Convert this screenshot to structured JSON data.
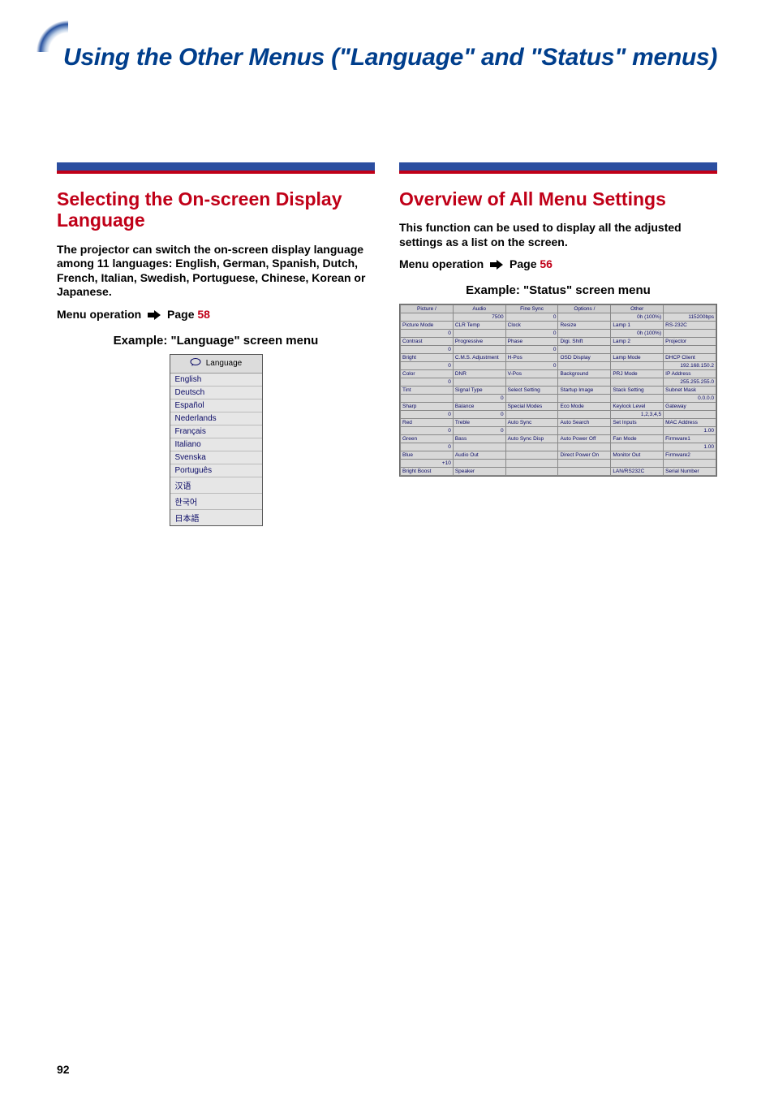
{
  "page_title": "Using the Other Menus (\"Language\" and \"Status\" menus)",
  "page_number": "92",
  "left": {
    "heading": "Selecting the On-screen Display Language",
    "body": "The projector can switch the on-screen display language among 11 languages: English, German, Spanish, Dutch, French, Italian, Swedish, Portuguese, Chinese, Korean or Japanese.",
    "menu_op_text": "Menu operation",
    "menu_op_page_label": "Page",
    "menu_op_page_num": "58",
    "example_label": "Example: \"Language\" screen menu",
    "language_header": "Language",
    "languages": [
      "English",
      "Deutsch",
      "Español",
      "Nederlands",
      "Français",
      "Italiano",
      "Svenska",
      "Português",
      "汉语",
      "한국어",
      "日本語"
    ]
  },
  "right": {
    "heading": "Overview of All Menu Settings",
    "body": "This function can be used to display all the adjusted settings as a list on the screen.",
    "menu_op_text": "Menu operation",
    "menu_op_page_label": "Page",
    "menu_op_page_num": "56",
    "example_label": "Example: \"Status\" screen menu",
    "status_headers": [
      "Picture",
      "Audio",
      "Fine Sync",
      "Options",
      "Other"
    ],
    "status_rows": [
      [
        {
          "l": "Picture Mode",
          "v": ""
        },
        {
          "l": "CLR Temp",
          "v": "7500"
        },
        {
          "l": "Clock",
          "v": "0"
        },
        {
          "l": "Resize",
          "v": ""
        },
        {
          "l": "Lamp 1",
          "v": "0h (100%)"
        },
        {
          "l": "RS-232C",
          "v": "115200bps"
        }
      ],
      [
        {
          "l": "Contrast",
          "v": "0"
        },
        {
          "l": "Progressive",
          "v": ""
        },
        {
          "l": "Phase",
          "v": "0"
        },
        {
          "l": "Digi. Shift",
          "v": ""
        },
        {
          "l": "Lamp 2",
          "v": "0h (100%)"
        },
        {
          "l": "Projector",
          "v": ""
        }
      ],
      [
        {
          "l": "Bright",
          "v": "0"
        },
        {
          "l": "C.M.S. Adjustment",
          "v": ""
        },
        {
          "l": "H-Pos",
          "v": "0"
        },
        {
          "l": "OSD Display",
          "v": ""
        },
        {
          "l": "Lamp Mode",
          "v": ""
        },
        {
          "l": "DHCP Client",
          "v": ""
        }
      ],
      [
        {
          "l": "Color",
          "v": "0"
        },
        {
          "l": "DNR",
          "v": ""
        },
        {
          "l": "V-Pos",
          "v": "0"
        },
        {
          "l": "Background",
          "v": ""
        },
        {
          "l": "PRJ Mode",
          "v": ""
        },
        {
          "l": "IP Address",
          "v": "192.168.150.2"
        }
      ],
      [
        {
          "l": "Tint",
          "v": "0"
        },
        {
          "l": "Signal Type",
          "v": ""
        },
        {
          "l": "Select Setting",
          "v": ""
        },
        {
          "l": "Startup Image",
          "v": ""
        },
        {
          "l": "Stack Setting",
          "v": ""
        },
        {
          "l": "Subnet Mask",
          "v": "255.255.255.0"
        }
      ],
      [
        {
          "l": "Sharp",
          "v": ""
        },
        {
          "l": "Balance",
          "v": "0"
        },
        {
          "l": "Special Modes",
          "v": ""
        },
        {
          "l": "Eco Mode",
          "v": ""
        },
        {
          "l": "Keylock Level",
          "v": ""
        },
        {
          "l": "Gateway",
          "v": "0.0.0.0"
        }
      ],
      [
        {
          "l": "Red",
          "v": "0"
        },
        {
          "l": "Treble",
          "v": "0"
        },
        {
          "l": "Auto Sync",
          "v": ""
        },
        {
          "l": "Auto Search",
          "v": ""
        },
        {
          "l": "Set Inputs",
          "v": "1,2,3,4,5"
        },
        {
          "l": "MAC Address",
          "v": ""
        }
      ],
      [
        {
          "l": "Green",
          "v": "0"
        },
        {
          "l": "Bass",
          "v": "0"
        },
        {
          "l": "Auto Sync Disp",
          "v": ""
        },
        {
          "l": "Auto Power Off",
          "v": ""
        },
        {
          "l": "Fan Mode",
          "v": ""
        },
        {
          "l": "Firmware1",
          "v": "1.00"
        }
      ],
      [
        {
          "l": "Blue",
          "v": "0"
        },
        {
          "l": "Audio Out",
          "v": ""
        },
        {
          "l": "",
          "v": ""
        },
        {
          "l": "Direct Power On",
          "v": ""
        },
        {
          "l": "Monitor Out",
          "v": ""
        },
        {
          "l": "Firmware2",
          "v": "1.00"
        }
      ],
      [
        {
          "l": "Bright Boost",
          "v": "+10"
        },
        {
          "l": "Speaker",
          "v": ""
        },
        {
          "l": "",
          "v": ""
        },
        {
          "l": "",
          "v": ""
        },
        {
          "l": "LAN/RS232C",
          "v": ""
        },
        {
          "l": "Serial Number",
          "v": ""
        }
      ]
    ]
  }
}
